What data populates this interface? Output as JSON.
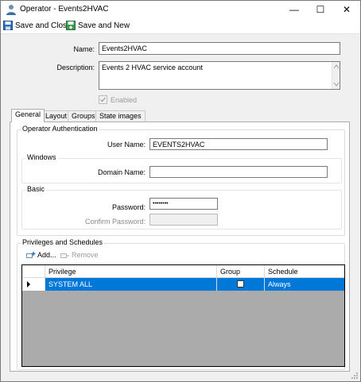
{
  "window": {
    "title": "Operator  -  Events2HVAC",
    "minimize_glyph": "—",
    "maximize_glyph": "☐",
    "close_glyph": "✕"
  },
  "toolbar": {
    "save_close_label": "Save and Close",
    "save_new_label": "Save and New"
  },
  "form": {
    "name_label": "Name:",
    "name_value": "Events2HVAC",
    "description_label": "Description:",
    "description_value": "Events 2 HVAC service account",
    "enabled_label": "Enabled",
    "enabled_checked": true
  },
  "tabs": [
    {
      "label": "General",
      "active": true
    },
    {
      "label": "Layout",
      "active": false
    },
    {
      "label": "Groups",
      "active": false
    },
    {
      "label": "State images",
      "active": false
    }
  ],
  "general": {
    "operator_auth_title": "Operator Authentication",
    "user_name_label": "User Name:",
    "user_name_value": "EVENTS2HVAC",
    "windows_title": "Windows",
    "domain_name_label": "Domain Name:",
    "domain_name_value": "",
    "basic_title": "Basic",
    "password_label": "Password:",
    "password_value": "••••••••",
    "confirm_password_label": "Confirm Password:",
    "confirm_password_value": ""
  },
  "privileges": {
    "title": "Privileges and Schedules",
    "add_label": "Add...",
    "remove_label": "Remove",
    "columns": [
      "Privilege",
      "Group",
      "Schedule"
    ],
    "rows": [
      {
        "privilege": "SYSTEM ALL",
        "group": false,
        "schedule": "Always",
        "selected": true
      }
    ]
  },
  "colors": {
    "selection": "#0078d7",
    "grid_background": "#ababab",
    "window_background": "#f0f0f0"
  }
}
